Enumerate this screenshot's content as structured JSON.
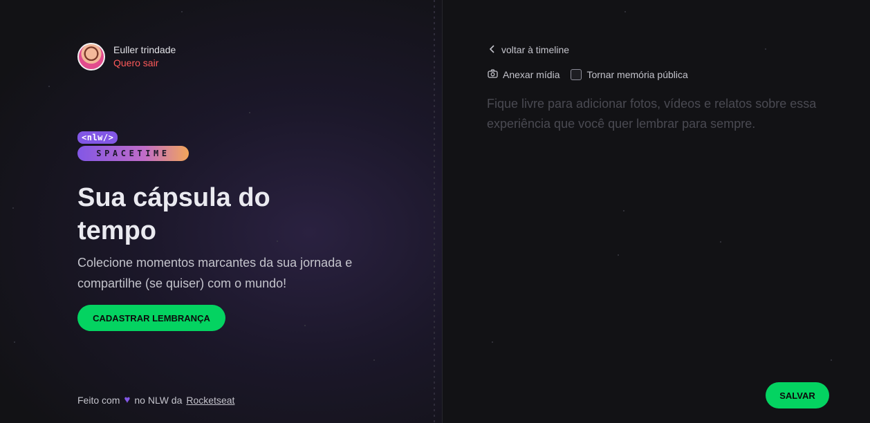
{
  "user": {
    "name": "Euller trindade",
    "logout_label": "Quero sair"
  },
  "logo": {
    "top": "<nlw/>",
    "bottom": "SPACETIME"
  },
  "hero": {
    "title": "Sua cápsula do tempo",
    "subtitle": "Colecione momentos marcantes da sua jornada e compartilhe (se quiser) com o mundo!",
    "cta_label": "CADASTRAR LEMBRANÇA"
  },
  "footer": {
    "prefix": "Feito com",
    "middle": "no NLW da",
    "link": "Rocketseat"
  },
  "editor": {
    "back_label": "voltar à timeline",
    "attach_label": "Anexar mídia",
    "public_label": "Tornar memória pública",
    "placeholder": "Fique livre para adicionar fotos, vídeos e relatos sobre essa experiência que você quer lembrar para sempre.",
    "save_label": "SALVAR"
  },
  "colors": {
    "accent_green": "#04d361",
    "accent_purple": "#8257e5",
    "logout_red": "#ff5a5a"
  },
  "icons": {
    "back": "chevron-left-icon",
    "attach": "camera-icon",
    "heart": "heart-icon"
  }
}
